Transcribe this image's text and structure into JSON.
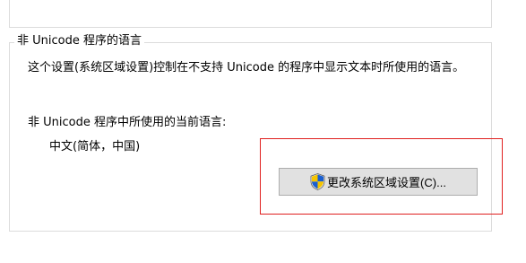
{
  "group": {
    "title": "非 Unicode 程序的语言",
    "description": "这个设置(系统区域设置)控制在不支持 Unicode 的程序中显示文本时所使用的语言。",
    "current_label": "非 Unicode 程序中所使用的当前语言:",
    "current_value": "中文(简体，中国)"
  },
  "change_button": {
    "label": "更改系统区域设置(C)...",
    "icon": "uac-shield-icon"
  },
  "colors": {
    "highlight": "#e0201f",
    "button_bg": "#e1e1e1",
    "button_border": "#adadad",
    "shield_blue": "#1a5fd0",
    "shield_yellow": "#f5c400"
  }
}
